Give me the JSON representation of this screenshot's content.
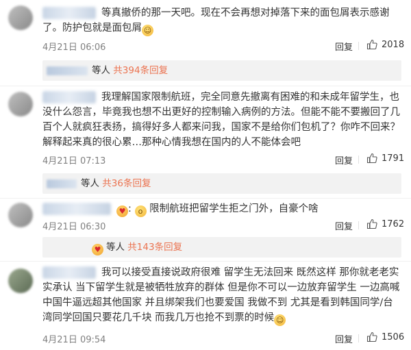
{
  "comments": [
    {
      "text": "等真撤侨的那一天吧。现在不会再想对掉落下来的面包屑表示感谢了。防护包就是面包屑",
      "time": "4月21日 06:06",
      "reply_label": "回复",
      "likes": "2018",
      "subreply": {
        "suffix": "等人",
        "link": "共394条回复"
      }
    },
    {
      "text": "我理解国家限制航班，完全同意先撤离有困难的和未成年留学生，也没什么怨言，毕竟我也想不出更好的控制输入病例的方法。但能不能不要搬回了几百个人就疯狂表扬，搞得好多人都来问我，国家不是给你们包机了？你咋不回来？解释起来真的很心累…那种心情我想在国内的人不能体会吧",
      "time": "4月21日 07:13",
      "reply_label": "回复",
      "likes": "1791",
      "subreply": {
        "suffix": "等人",
        "link": "共36条回复"
      }
    },
    {
      "text": "限制航班把留学生拒之门外，自豪个啥",
      "time": "4月21日 06:30",
      "reply_label": "回复",
      "likes": "1762",
      "subreply": {
        "suffix": "等人",
        "link": "共143条回复"
      }
    },
    {
      "text": "我可以接受直接说政府很难 留学生无法回来 既然这样 那你就老老实实承认 当下留学生就是被牺牲放弃的群体 但是你不可以一边放弃留学生 一边高喊中国牛逼远超其他国家 并且绑架我们也要爱国  我做不到 尤其是看到韩国同学/台湾同学回国只要花几千块 而我几万也抢不到票的时候",
      "time": "4月21日 09:54",
      "reply_label": "回复",
      "likes": "1506"
    }
  ],
  "colors": {
    "link": "#eb7350",
    "time": "#808080",
    "subreply_bg": "#f2f2f2"
  },
  "icons": {
    "like": "thumbs-up-icon",
    "emoji": "smile-emoji-icon",
    "heart_emoji": "heart-eyes-emoji-icon"
  }
}
